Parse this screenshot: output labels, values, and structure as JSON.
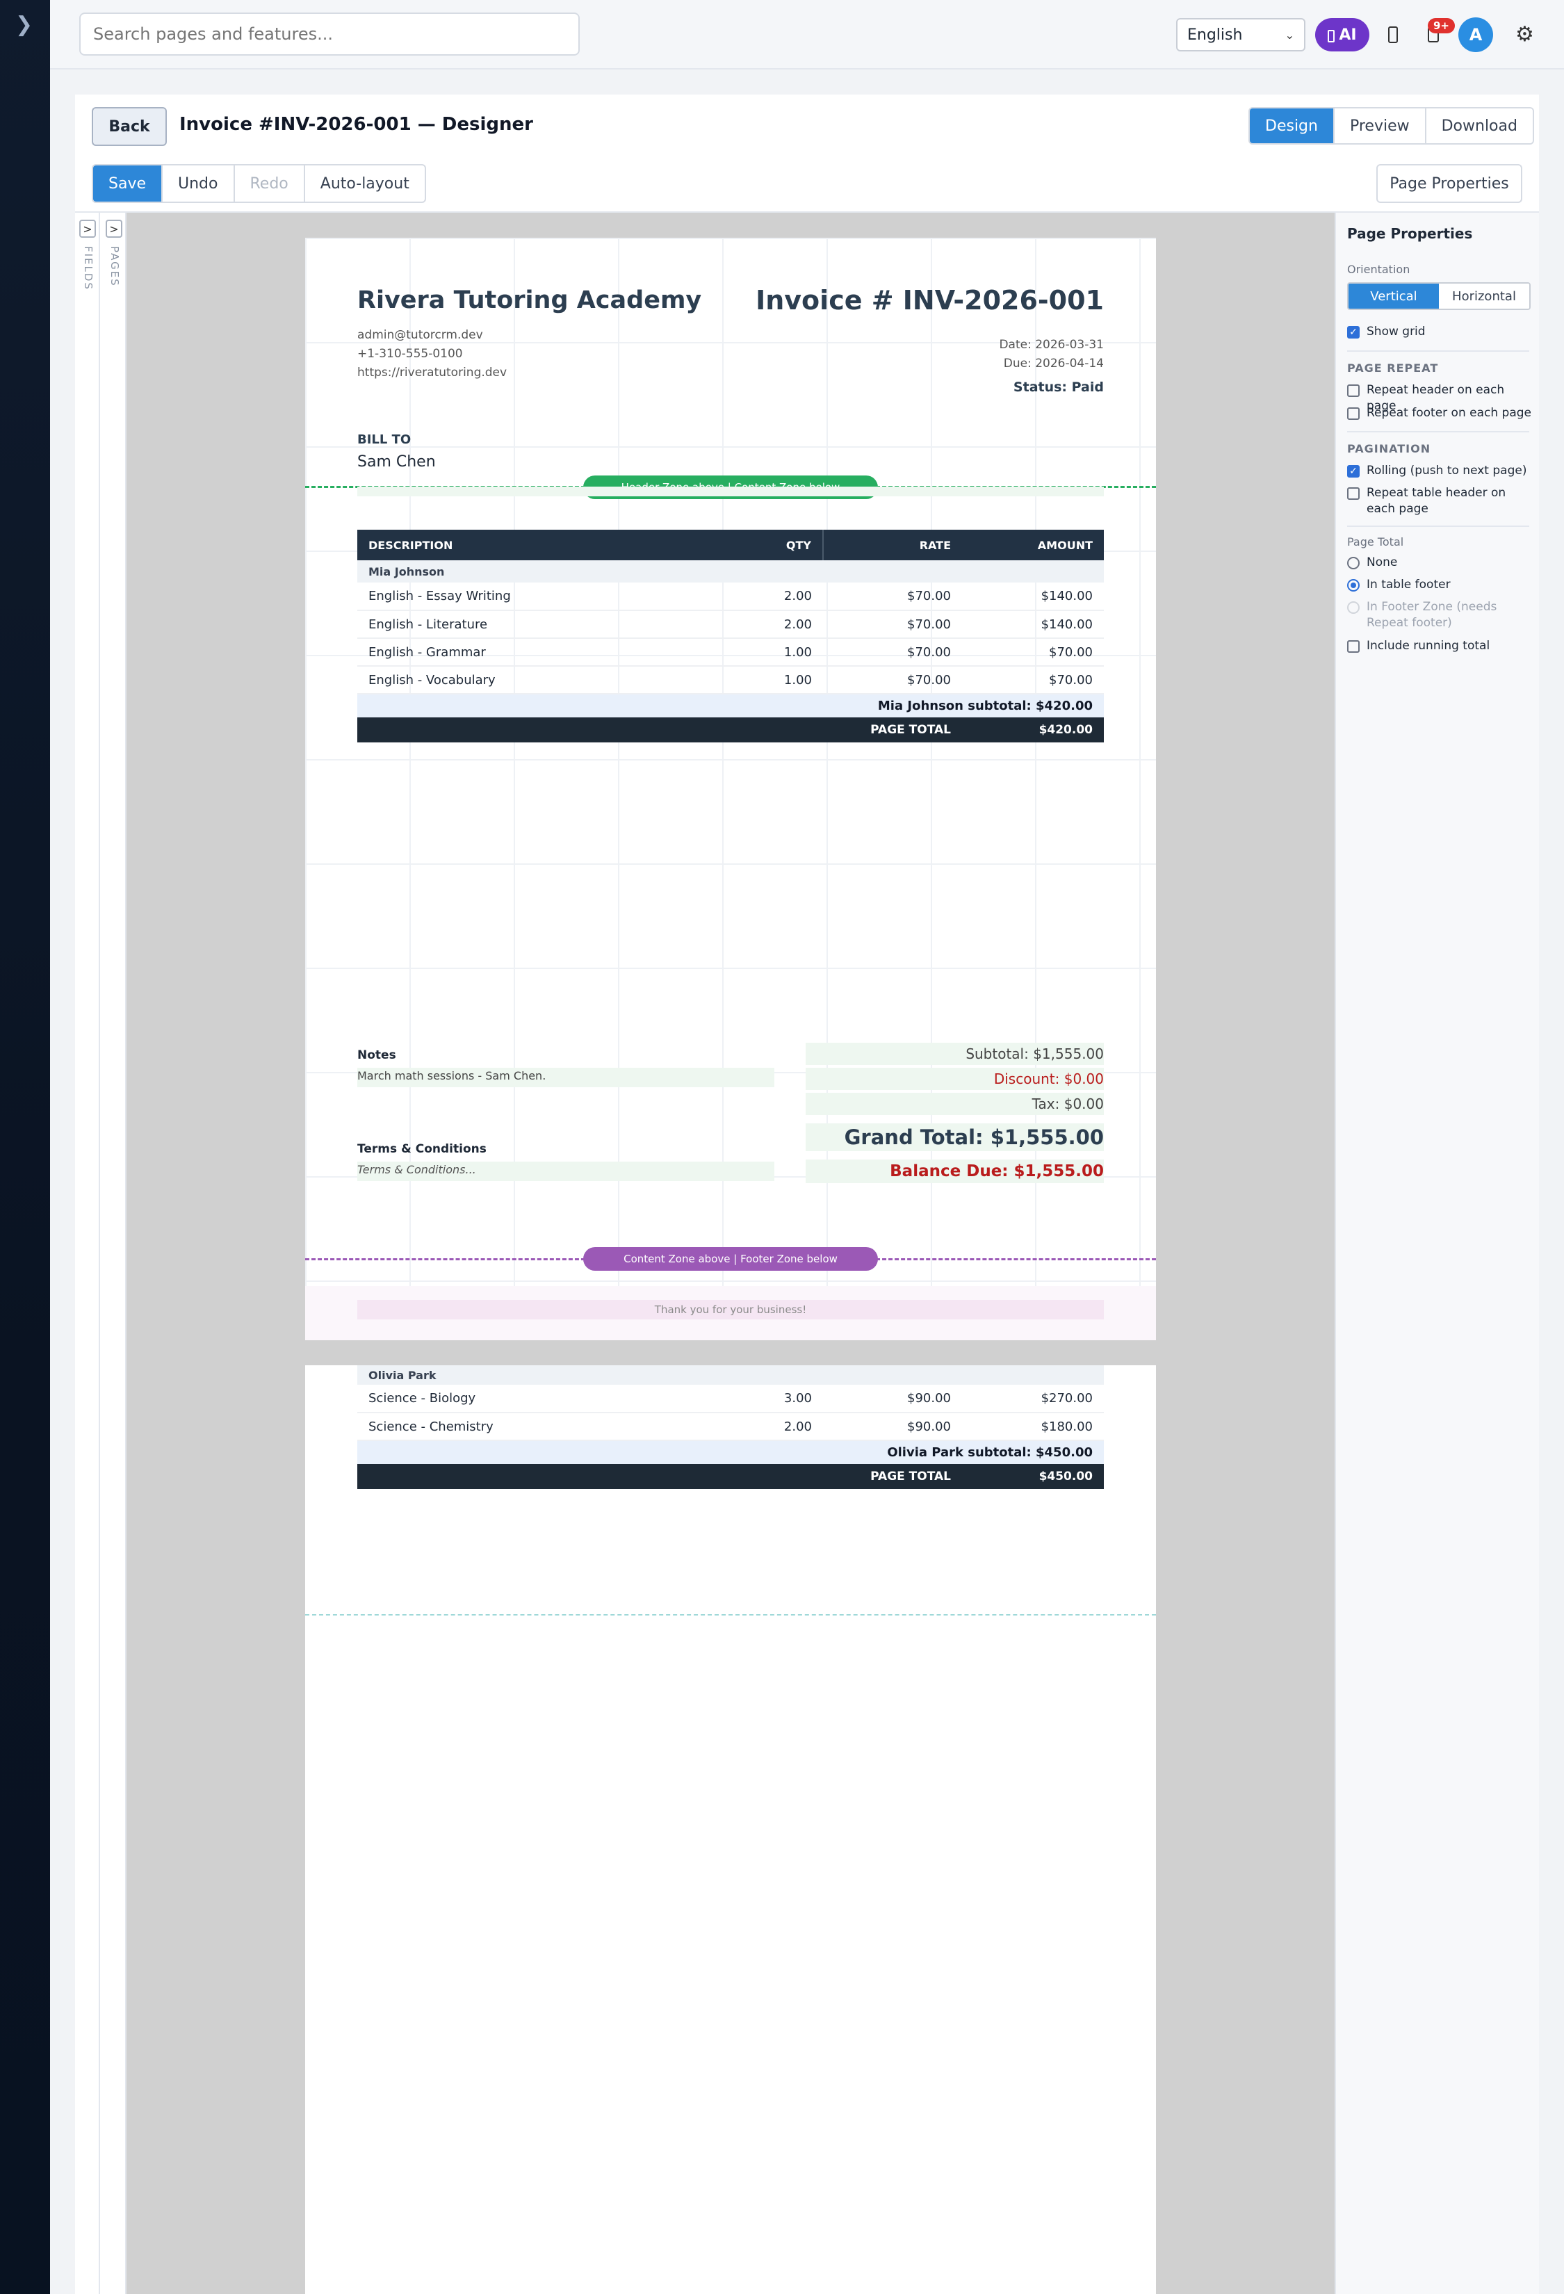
{
  "topbar": {
    "search_placeholder": "Search pages and features...",
    "language": "English",
    "ai_label": "AI",
    "notification_badge": "9+",
    "avatar_initial": "A"
  },
  "designer": {
    "back_label": "Back",
    "title": "Invoice #INV-2026-001 — Designer",
    "modes": [
      "Design",
      "Preview",
      "Download"
    ],
    "active_mode": "Design",
    "toolbar": {
      "save": "Save",
      "undo": "Undo",
      "redo": "Redo",
      "auto_layout": "Auto-layout"
    },
    "page_properties_button": "Page Properties",
    "side_tabs": {
      "fields": "FIELDS",
      "pages": "PAGES"
    }
  },
  "invoice": {
    "company": "Rivera Tutoring Academy",
    "email": "admin@tutorcrm.dev",
    "phone": "+1-310-555-0100",
    "website": "https://riveratutoring.dev",
    "invoice_number": "Invoice # INV-2026-001",
    "date": "Date: 2026-03-31",
    "due": "Due: 2026-04-14",
    "status": "Status: Paid",
    "bill_to_heading": "BILL TO",
    "bill_to_name": "Sam Chen",
    "header_zone_label": "Header Zone above | Content Zone below",
    "footer_zone_label": "Content Zone above | Footer Zone below",
    "columns": {
      "description": "DESCRIPTION",
      "qty": "QTY",
      "rate": "RATE",
      "amount": "AMOUNT"
    },
    "page1": {
      "student": "Mia Johnson",
      "rows": [
        {
          "description": "English - Essay Writing",
          "qty": "2.00",
          "rate": "$70.00",
          "amount": "$140.00"
        },
        {
          "description": "English - Literature",
          "qty": "2.00",
          "rate": "$70.00",
          "amount": "$140.00"
        },
        {
          "description": "English - Grammar",
          "qty": "1.00",
          "rate": "$70.00",
          "amount": "$70.00"
        },
        {
          "description": "English - Vocabulary",
          "qty": "1.00",
          "rate": "$70.00",
          "amount": "$70.00"
        }
      ],
      "subtotal": "Mia Johnson subtotal: $420.00",
      "page_total_label": "PAGE TOTAL",
      "page_total": "$420.00"
    },
    "page2": {
      "student": "Olivia Park",
      "rows": [
        {
          "description": "Science - Biology",
          "qty": "3.00",
          "rate": "$90.00",
          "amount": "$270.00"
        },
        {
          "description": "Science - Chemistry",
          "qty": "2.00",
          "rate": "$90.00",
          "amount": "$180.00"
        }
      ],
      "subtotal": "Olivia Park subtotal: $450.00",
      "page_total_label": "PAGE TOTAL",
      "page_total": "$450.00"
    },
    "notes_heading": "Notes",
    "notes": "March math sessions - Sam Chen.",
    "terms_heading": "Terms & Conditions",
    "terms": "Terms & Conditions...",
    "subtotal": "Subtotal: $1,555.00",
    "discount": "Discount: $0.00",
    "tax": "Tax: $0.00",
    "grand_total": "Grand Total: $1,555.00",
    "balance_due": "Balance Due: $1,555.00",
    "footer_text": "Thank you for your business!"
  },
  "properties": {
    "heading": "Page Properties",
    "orientation_label": "Orientation",
    "orientation_options": [
      "Vertical",
      "Horizontal"
    ],
    "orientation_selected": "Vertical",
    "show_grid": "Show grid",
    "page_repeat_heading": "PAGE REPEAT",
    "repeat_header": "Repeat header on each page",
    "repeat_footer": "Repeat footer on each page",
    "pagination_heading": "PAGINATION",
    "rolling": "Rolling (push to next page)",
    "repeat_table_header": "Repeat table header on each page",
    "page_total_heading": "Page Total",
    "page_total_none": "None",
    "page_total_table_footer": "In table footer",
    "page_total_footer_zone": "In Footer Zone (needs Repeat footer)",
    "running_total": "Include running total"
  },
  "colors": {
    "accent": "#2d87d8",
    "ai_purple": "#6d35c9",
    "header_zone": "#27ae60",
    "footer_zone": "#9b59b6",
    "table_header": "#223244",
    "danger": "#b91c1c"
  }
}
